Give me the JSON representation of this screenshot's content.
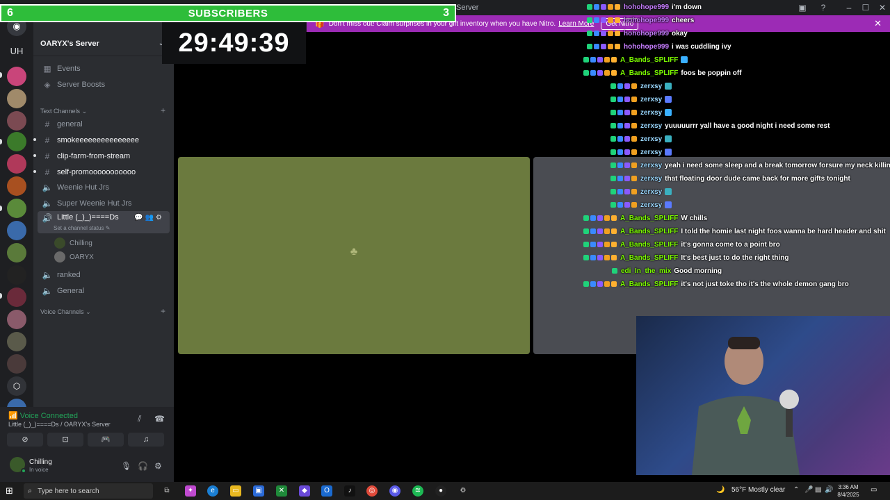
{
  "window": {
    "title": "Server",
    "minimize": "–",
    "maximize": "☐",
    "close": "✕",
    "icon1": "▣",
    "icon2": "?"
  },
  "nitro_banner": {
    "text": "Don't miss out! Claim surprises in your gift inventory when you have Nitro.",
    "link": "Learn More",
    "button": "Get Nitro",
    "close": "✕"
  },
  "overlay": {
    "sub_left": "6",
    "sub_label": "SUBSCRIBERS",
    "sub_right": "3",
    "timer": "29:49:39"
  },
  "rail": {
    "initials": "UH"
  },
  "server": {
    "name": "OARYX's Server",
    "chevron": "⌄"
  },
  "nav": {
    "events": "Events",
    "boosts": "Server Boosts"
  },
  "categories": {
    "text": "Text Channels",
    "voice": "Voice Channels",
    "chev": "⌄",
    "plus": "+"
  },
  "text_channels": [
    {
      "name": "general"
    },
    {
      "name": "smokeeeeeeeeeeeeeee"
    },
    {
      "name": "clip-farm-from-stream"
    },
    {
      "name": "self-promooooooooooo"
    }
  ],
  "voice_channels": [
    {
      "name": "Weenie Hut Jrs"
    },
    {
      "name": "Super Weenie Hut Jrs"
    },
    {
      "name": "Little (_)_)====Ds",
      "status": "Set a channel status ✎"
    },
    {
      "name": "ranked"
    },
    {
      "name": "General"
    }
  ],
  "voice_members": [
    {
      "name": "Chilling"
    },
    {
      "name": "OARYX"
    }
  ],
  "voice_panel": {
    "title": "Voice Connected",
    "subtitle": "Little (_)_)====Ds / OARYX's Server",
    "user_name": "Chilling",
    "user_status": "In voice"
  },
  "chat": [
    {
      "user": "hohohope999",
      "msg": "i'm down",
      "color": "#c77dff"
    },
    {
      "user": "hohohope999",
      "msg": "cheers",
      "color": "#c77dff"
    },
    {
      "user": "hohohope999",
      "msg": "okay",
      "color": "#c77dff"
    },
    {
      "user": "hohohope999",
      "msg": "i was cuddling ivy",
      "color": "#c77dff"
    },
    {
      "user": "A_Bands_SPLIFF",
      "msg": "",
      "color": "#7cfc00"
    },
    {
      "user": "A_Bands_SPLIFF",
      "msg": "foos be poppin off",
      "color": "#7cfc00"
    },
    {
      "user": "zerxsy",
      "msg": "",
      "color": "#9ad8ff"
    },
    {
      "user": "zerxsy",
      "msg": "",
      "color": "#9ad8ff"
    },
    {
      "user": "zerxsy",
      "msg": "",
      "color": "#9ad8ff"
    },
    {
      "user": "zerxsy",
      "msg": "yuuuuurrr yall have a good night i need some rest",
      "color": "#9ad8ff"
    },
    {
      "user": "zerxsy",
      "msg": "",
      "color": "#9ad8ff"
    },
    {
      "user": "zerxsy",
      "msg": "",
      "color": "#9ad8ff"
    },
    {
      "user": "zerxsy",
      "msg": "yeah i need some sleep and a break tomorrow forsure my neck killing",
      "color": "#9ad8ff"
    },
    {
      "user": "zerxsy",
      "msg": "that floating door dude came back for more gifts tonight",
      "color": "#9ad8ff"
    },
    {
      "user": "zerxsy",
      "msg": "",
      "color": "#9ad8ff"
    },
    {
      "user": "zerxsy",
      "msg": "",
      "color": "#9ad8ff"
    },
    {
      "user": "A_Bands_SPLIFF",
      "msg": "W chills",
      "color": "#7cfc00"
    },
    {
      "user": "A_Bands_SPLIFF",
      "msg": "I told the homie last night foos wanna be hard header and shit",
      "color": "#7cfc00"
    },
    {
      "user": "A_Bands_SPLIFF",
      "msg": "it's gonna come to a point bro",
      "color": "#7cfc00"
    },
    {
      "user": "A_Bands_SPLIFF",
      "msg": "It's best just to do the right thing",
      "color": "#7cfc00"
    },
    {
      "user": "edi_In_the_mix",
      "msg": "Good morning",
      "color": "#7cfc00"
    },
    {
      "user": "A_Bands_SPLIFF",
      "msg": "it's not just toke tho it's the whole demon gang bro",
      "color": "#7cfc00"
    }
  ],
  "taskbar": {
    "search_placeholder": "Type here to search",
    "weather": "56°F Mostly clear",
    "time": "3:36 AM",
    "date": "8/4/2025"
  },
  "colors": {
    "nitro": "#9c2bb5",
    "subs": "#2ebd3a",
    "voice_connected": "#23a55a",
    "tile_green": "#6b7a3e"
  }
}
